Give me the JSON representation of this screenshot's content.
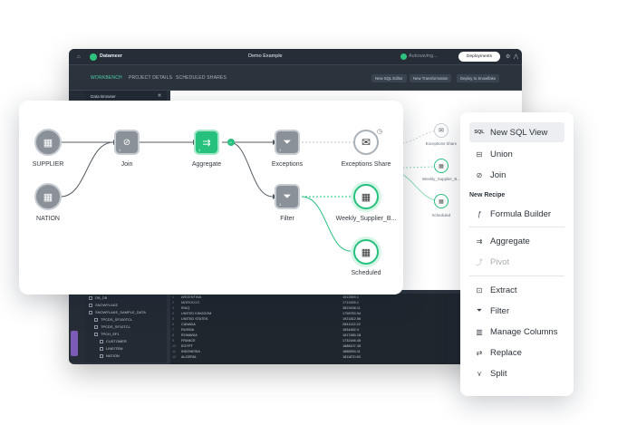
{
  "app": {
    "name": "Datameer",
    "project": "Demo Example",
    "status": "Autosaving...",
    "deploy_label": "Deployments"
  },
  "tabs": [
    {
      "label": "WORKBENCH"
    },
    {
      "label": "PROJECT DETAILS"
    },
    {
      "label": "SCHEDULED SHARES"
    }
  ],
  "toolbar": {
    "new_sql": "New SQL Editor",
    "new_transformation": "New Transformation",
    "deploy_snowflake": "Deploy to Snowflake"
  },
  "side_panel": {
    "header": "Data Browser"
  },
  "tree": [
    {
      "label": "DB_DB"
    },
    {
      "label": "SNOWFLAKE"
    },
    {
      "label": "SNOWFLAKE_SAMPLE_DATA"
    },
    {
      "label": "TPCDS_SF100TCL"
    },
    {
      "label": "TPCDS_SF10TCL"
    },
    {
      "label": "TPCH_SF1"
    },
    {
      "label": "CUSTOMER"
    },
    {
      "label": "LINEITEM"
    },
    {
      "label": "NATION"
    }
  ],
  "grid_rows": [
    {
      "n": "1",
      "name": "ARGENTINA",
      "val": "1513559.1"
    },
    {
      "n": "2",
      "name": "MOROCCO",
      "val": "1713455.1"
    },
    {
      "n": "3",
      "name": "IRAQ",
      "val": "3823438.11"
    },
    {
      "n": "4",
      "name": "UNITED KINGDOM",
      "val": "1798750.94"
    },
    {
      "n": "5",
      "name": "UNITED STATES",
      "val": "1921812.56"
    },
    {
      "n": "6",
      "name": "CANADA",
      "val": "2841122.22"
    },
    {
      "n": "7",
      "name": "RUSSIA",
      "val": "1834452.4"
    },
    {
      "n": "8",
      "name": "ROMANIA",
      "val": "1617480.18"
    },
    {
      "n": "9",
      "name": "FRANCE",
      "val": "1732446.45"
    },
    {
      "n": "10",
      "name": "EGYPT",
      "val": "1888107.45"
    },
    {
      "n": "11",
      "name": "INDONESIA",
      "val": "1888534.11"
    },
    {
      "n": "12",
      "name": "ALGERIA",
      "val": "1811870.63"
    }
  ],
  "flow": {
    "supplier": "SUPPLIER",
    "nation": "NATION",
    "join": "Join",
    "aggregate": "Aggregate",
    "exceptions": "Exceptions",
    "filter": "Filter",
    "exceptions_share": "Exceptions Share",
    "weekly": "Weekly_Supplier_B...",
    "scheduled": "Scheduled"
  },
  "bg_flow": {
    "exceptions_share": "Exceptions Share",
    "weekly": "Weekly_Supplier_B...",
    "scheduled": "Scheduled"
  },
  "menu": {
    "items_top": [
      {
        "label": "New SQL View",
        "icon": "sql-icon",
        "active": true
      },
      {
        "label": "Union",
        "icon": "union-icon"
      },
      {
        "label": "Join",
        "icon": "join-icon"
      }
    ],
    "section_title": "New Recipe",
    "recipe_items": [
      {
        "label": "Formula Builder",
        "icon": "function-icon"
      },
      {
        "label": "Aggregate",
        "icon": "aggregate-icon"
      },
      {
        "label": "Pivot",
        "icon": "pivot-icon",
        "disabled": true
      },
      {
        "label": "Extract",
        "icon": "extract-icon"
      },
      {
        "label": "Filter",
        "icon": "filter-icon"
      },
      {
        "label": "Manage Columns",
        "icon": "columns-icon"
      },
      {
        "label": "Replace",
        "icon": "replace-icon"
      },
      {
        "label": "Split",
        "icon": "split-icon"
      }
    ]
  },
  "colors": {
    "accent": "#27c17e",
    "node_gray": "#8a9199",
    "dark_bg": "#2b333d"
  }
}
